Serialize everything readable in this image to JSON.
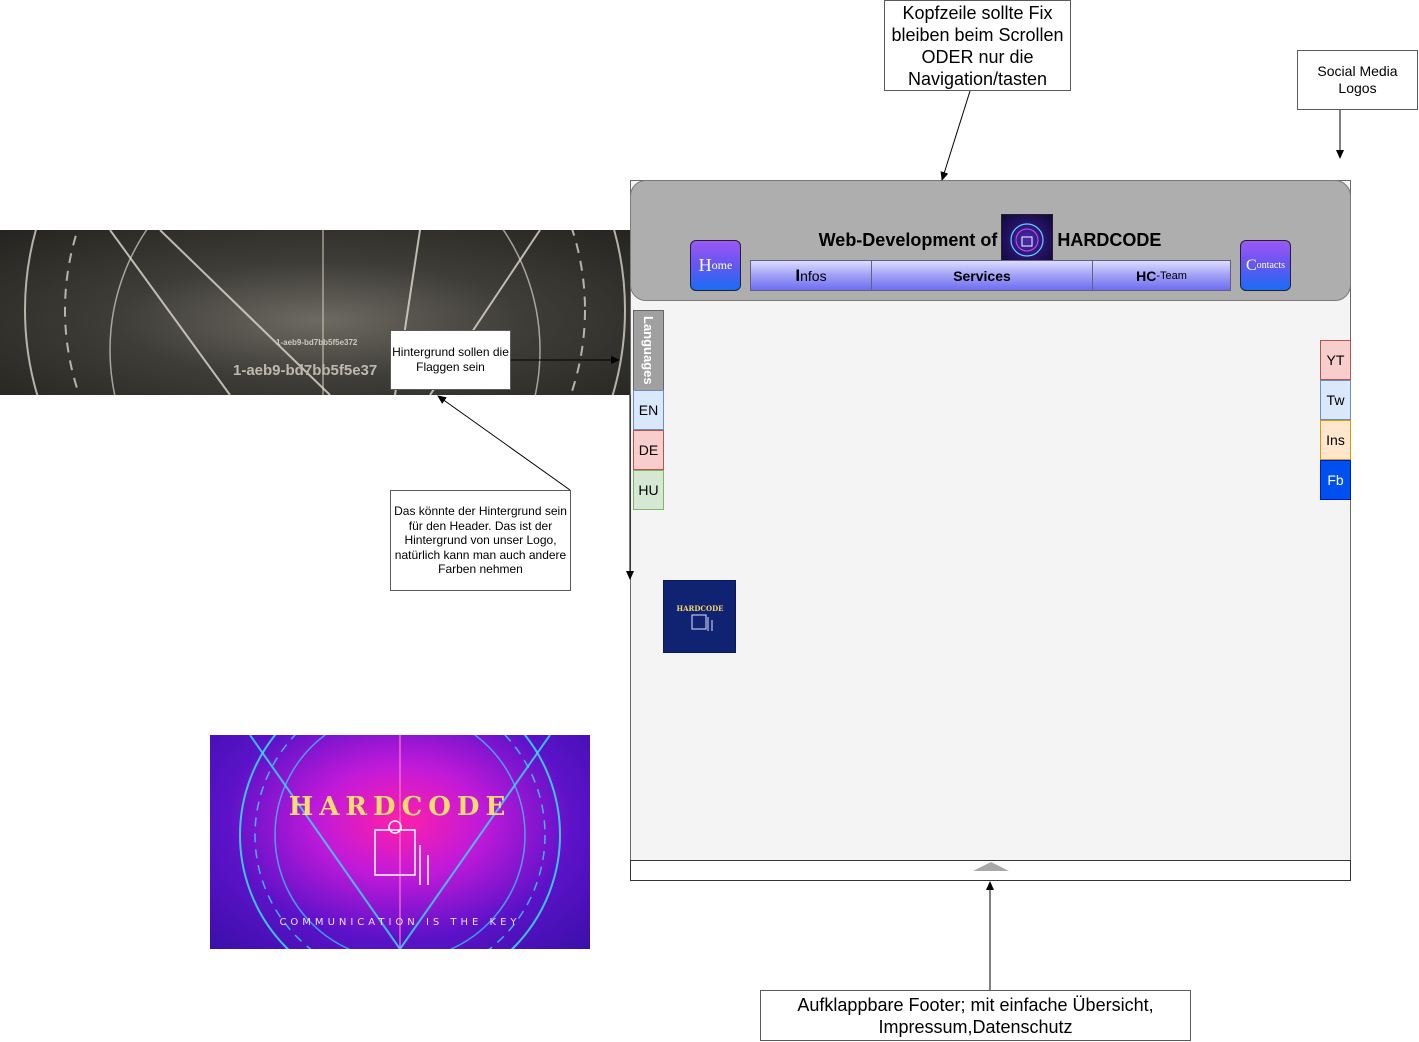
{
  "annotations": {
    "header_fixed": "Kopfzeile sollte Fix bleiben beim Scrollen ODER nur die Navigation/tasten",
    "social_logos": "Social Media Logos",
    "flags_background": "Hintergrund sollen die Flaggen sein",
    "header_background": "Das könnte der Hintergrund sein für den Header. Das ist der Hintergrund von unser Logo, natürlich kann man auch andere Farben nehmen",
    "footer": "Aufklappbare Footer; mit einfache Übersicht, Impressum,Datenschutz"
  },
  "bg_image_text": {
    "line1": "1-aeb9-bd7bb5f5e372",
    "line2": "1-aeb9-bd7bb5f5e37"
  },
  "header": {
    "title_prefix": "Web-Development of",
    "title_brand": "HARDCODE",
    "home": {
      "initial": "H",
      "rest": "ome"
    },
    "contacts": {
      "initial": "C",
      "rest": "ontacts"
    },
    "nav": {
      "infos": {
        "initial": "I",
        "rest": "nfos"
      },
      "services": "Services",
      "team": {
        "main": "HC",
        "rest": "-Team"
      }
    }
  },
  "languages": {
    "label": "Languages",
    "items": [
      "EN",
      "DE",
      "HU"
    ],
    "colors": [
      "#dae8fc",
      "#f8cecc",
      "#d5e8d4"
    ]
  },
  "social": {
    "items": [
      "YT",
      "Tw",
      "Ins",
      "Fb"
    ],
    "colors": [
      "#f8cecc",
      "#dae8fc",
      "#ffe6cc",
      "#0050ef"
    ]
  },
  "logo": {
    "brand": "HARDCODE",
    "slogan": "COMMUNICATION IS THE KEY"
  },
  "colors": {
    "header_bg": "#aeaeae",
    "page_bg": "#f4f4f4",
    "nav_gradient": "#9a9af5",
    "button_gradient": "#6a55f0",
    "logo_blue": "#102372"
  }
}
